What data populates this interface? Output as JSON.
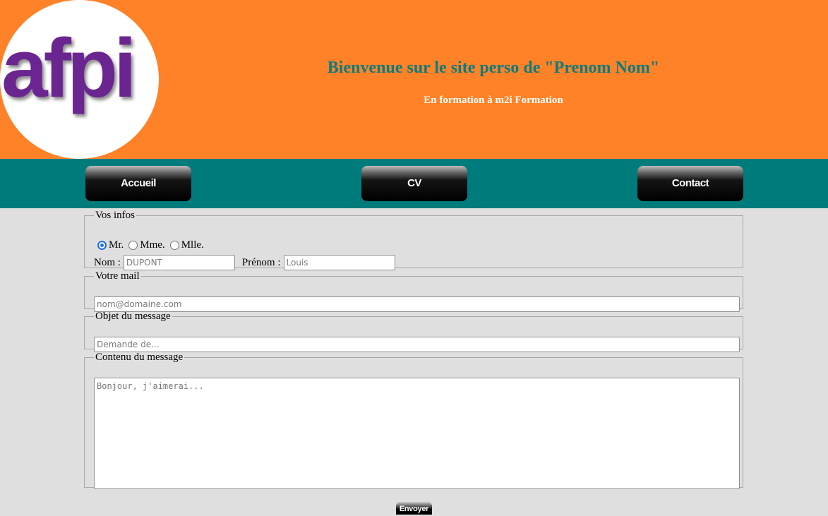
{
  "header": {
    "logo_text": "afpi",
    "title": "Bienvenue sur le site perso de \"Prenom Nom\"",
    "subtitle": "En formation à m2i Formation"
  },
  "nav": {
    "items": [
      {
        "label": "Accueil"
      },
      {
        "label": "CV"
      },
      {
        "label": "Contact"
      }
    ]
  },
  "form": {
    "infos": {
      "legend": "Vos infos",
      "civilite": [
        {
          "label": "Mr.",
          "checked": true
        },
        {
          "label": "Mme.",
          "checked": false
        },
        {
          "label": "Mlle.",
          "checked": false
        }
      ],
      "nom_label": "Nom :",
      "nom_placeholder": "DUPONT",
      "prenom_label": "Prénom :",
      "prenom_placeholder": "Louis"
    },
    "mail": {
      "legend": "Votre mail",
      "placeholder": "nom@domaine.com"
    },
    "objet": {
      "legend": "Objet du message",
      "placeholder": "Demande de..."
    },
    "contenu": {
      "legend": "Contenu du message",
      "placeholder": "Bonjour, j'aimerai..."
    },
    "submit_label": "Envoyer"
  },
  "colors": {
    "header_bg": "#ff8228",
    "nav_bg": "#007b7c",
    "title_color": "#0e7b7c",
    "logo_color": "#6a2590",
    "page_bg": "#dfdfdf"
  }
}
